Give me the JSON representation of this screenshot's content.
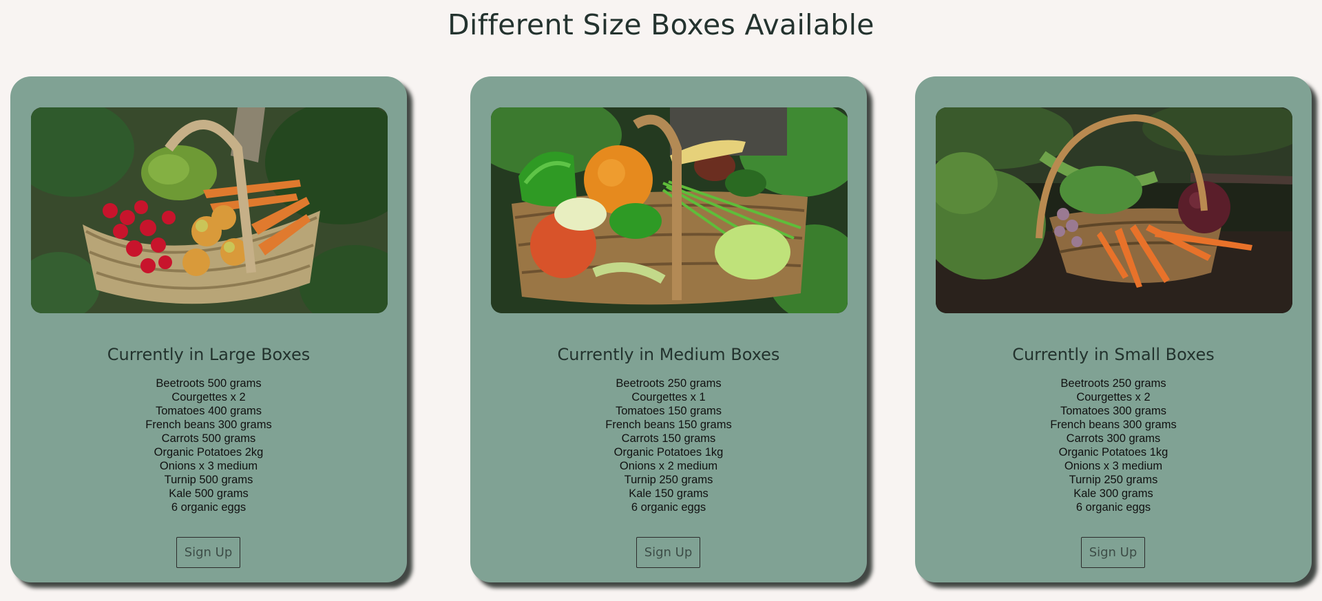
{
  "page": {
    "title": "Different Size Boxes Available"
  },
  "colors": {
    "background": "#f8f4f2",
    "card": "#80a294",
    "text": "#23332e"
  },
  "boxes": [
    {
      "title": "Currently in Large Boxes",
      "image": "basket-of-radishes-apples-carrots-broccoli",
      "items": [
        "Beetroots 500 grams",
        "Courgettes x 2",
        "Tomatoes 400 grams",
        "French beans 300 grams",
        "Carrots 500 grams",
        "Organic Potatoes 2kg",
        "Onions x 3 medium",
        "Turnip 500 grams",
        "Kale 500 grams",
        "6 organic eggs"
      ],
      "button": "Sign Up"
    },
    {
      "title": "Currently in Medium Boxes",
      "image": "basket-of-peppers-tomatoes-leeks-squash",
      "items": [
        "Beetroots 250 grams",
        "Courgettes x 1",
        "Tomatoes 150 grams",
        "French beans 150 grams",
        "Carrots 150 grams",
        "Organic Potatoes 1kg",
        "Onions x 2 medium",
        "Turnip 250 grams",
        "Kale 150 grams",
        "6 organic eggs"
      ],
      "button": "Sign Up"
    },
    {
      "title": "Currently in Small Boxes",
      "image": "basket-of-carrots-beetroot-onions",
      "items": [
        "Beetroots 250 grams",
        "Courgettes x 2",
        "Tomatoes 300 grams",
        "French beans 300 grams",
        "Carrots 300 grams",
        "Organic Potatoes 1kg",
        "Onions x 3 medium",
        "Turnip 250 grams",
        "Kale 300 grams",
        "6 organic eggs"
      ],
      "button": "Sign Up"
    }
  ]
}
